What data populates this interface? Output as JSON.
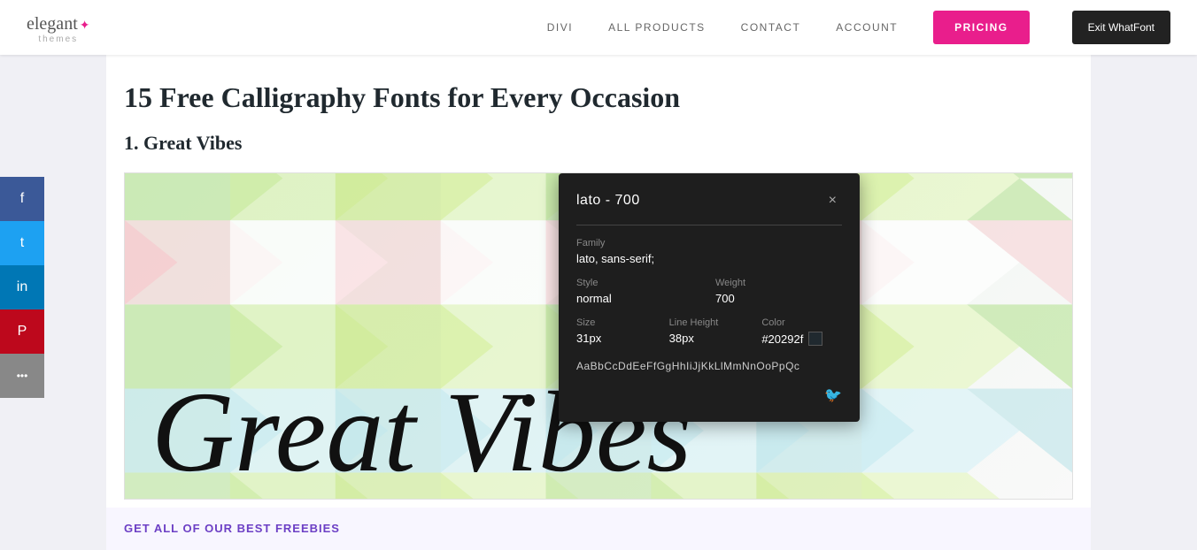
{
  "header": {
    "logo_text": "elegant",
    "logo_sub": "themes",
    "nav": {
      "items": [
        {
          "label": "DIVI",
          "id": "divi"
        },
        {
          "label": "ALL PRODUCTS",
          "id": "all-products"
        },
        {
          "label": "CONTACT",
          "id": "contact"
        },
        {
          "label": "ACCOUNT",
          "id": "account"
        }
      ],
      "pricing_label": "PRICING",
      "exit_label": "Exit WhatFont"
    }
  },
  "social": {
    "buttons": [
      {
        "label": "f",
        "platform": "facebook"
      },
      {
        "label": "t",
        "platform": "twitter"
      },
      {
        "label": "in",
        "platform": "linkedin"
      },
      {
        "label": "P",
        "platform": "pinterest"
      },
      {
        "label": "...",
        "platform": "more"
      }
    ]
  },
  "article": {
    "title": "15 Free Calligraphy Fonts for Every Occasion",
    "section_1": "1. Great Vibes",
    "font_display_text": "Great Vibes",
    "cta_text": "GET ALL OF OUR BEST FREEBIES"
  },
  "whatfont": {
    "title": "lato - 700",
    "close_label": "×",
    "family_label": "Family",
    "family_value": "lato, sans-serif;",
    "style_label": "Style",
    "style_value": "normal",
    "weight_label": "Weight",
    "weight_value": "700",
    "size_label": "Size",
    "size_value": "31px",
    "line_height_label": "Line Height",
    "line_height_value": "38px",
    "color_label": "Color",
    "color_value": "#20292f",
    "color_hex": "#20292f",
    "alphabet": "AaBbCcDdEeFfGgHhIiJjKkLlMmNnOoPpQc",
    "twitter_icon": "🐦"
  }
}
